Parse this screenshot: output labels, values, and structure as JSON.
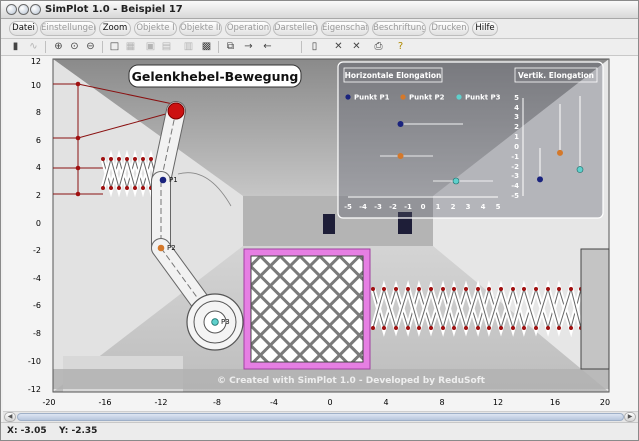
{
  "window": {
    "title": "SimPlot 1.0 - Beispiel 17"
  },
  "menu": [
    {
      "label": "Datei",
      "active": true
    },
    {
      "label": "Einstellungen",
      "active": false
    },
    {
      "label": "Zoom",
      "active": true
    },
    {
      "label": "Objekte I",
      "active": false
    },
    {
      "label": "Objekte II",
      "active": false
    },
    {
      "label": "Operation",
      "active": false
    },
    {
      "label": "Darstellen",
      "active": false
    },
    {
      "label": "Eigenschaft",
      "active": false
    },
    {
      "label": "Beschriftung",
      "active": false
    },
    {
      "label": "Drucken",
      "active": false
    },
    {
      "label": "Hilfe",
      "active": true
    }
  ],
  "toolbar_icons": [
    "calculator-icon",
    "curve-icon",
    "zoom-in-icon",
    "zoom-reset-icon",
    "zoom-out-icon",
    "rectangle-icon",
    "grid-icon",
    "frame-icon",
    "layers-icon",
    "table-icon",
    "image-icon",
    "copy-icon",
    "arrow-right-icon",
    "arrow-left-icon",
    "page-icon",
    "cross-icon",
    "cross-alt-icon",
    "printer-icon",
    "help-icon"
  ],
  "plot": {
    "title": "Gelenkhebel-Bewegung",
    "watermark": "© Created with SimPlot 1.0 - Developed by ReduSoft",
    "x_ticks": [
      "-20",
      "-16",
      "-12",
      "-8",
      "-4",
      "0",
      "4",
      "8",
      "12",
      "16",
      "20"
    ],
    "y_ticks": [
      "12",
      "10",
      "8",
      "6",
      "4",
      "2",
      "0",
      "-2",
      "-4",
      "-6",
      "-8",
      "-10",
      "-12"
    ],
    "point_labels": {
      "p1": "P1",
      "p2": "P2",
      "p3": "P3"
    },
    "colors": {
      "p1": "#1a237e",
      "p2": "#d4782a",
      "p3": "#5fd0cc",
      "joint": "#cc1111",
      "frame": "#e67fe3"
    }
  },
  "inset": {
    "horizontal_title": "Horizontale Elongation",
    "vertical_title": "Vertik. Elongation",
    "legend": [
      "Punkt P1",
      "Punkt P2",
      "Punkt P3"
    ],
    "x_ticks": [
      "-5",
      "-4",
      "-3",
      "-2",
      "-1",
      "0",
      "1",
      "2",
      "3",
      "4",
      "5"
    ],
    "y_ticks": [
      "5",
      "4",
      "3",
      "2",
      "1",
      "0",
      "-1",
      "-2",
      "-3",
      "-4",
      "-5"
    ],
    "horizontal_values": {
      "p1": -1.5,
      "p2": -1.5,
      "p3": 2.2
    },
    "vertical_values": {
      "p1": -3.2,
      "p2": -0.5,
      "p3": -2.2
    }
  },
  "status": {
    "x": "X: -3.05",
    "y": "Y: -2.35"
  }
}
